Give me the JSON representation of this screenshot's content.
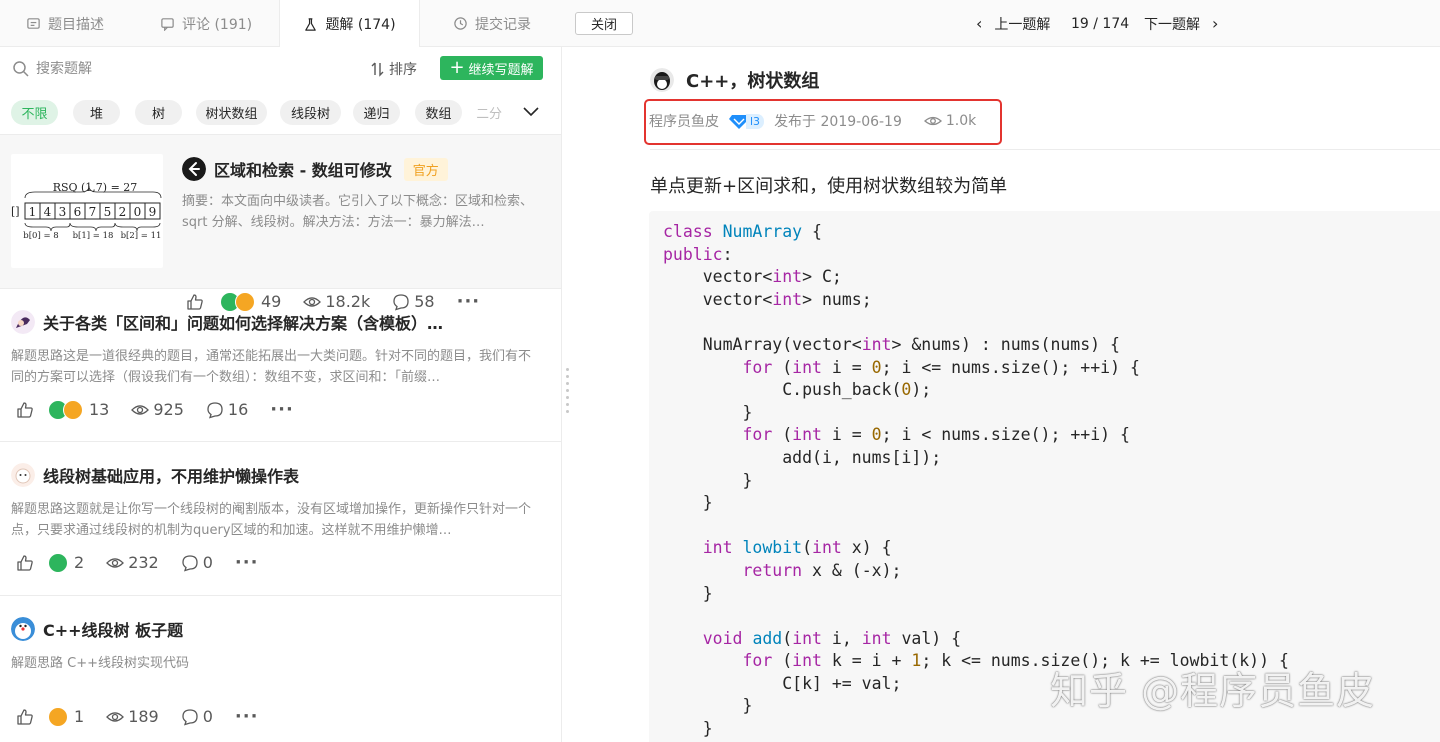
{
  "tabs": [
    {
      "label": "题目描述"
    },
    {
      "label": "评论 (191)"
    },
    {
      "label": "题解 (174)"
    },
    {
      "label": "提交记录"
    }
  ],
  "close_label": "关闭",
  "pager": {
    "prev_label": "上一题解",
    "position": "19 / 174",
    "next_label": "下一题解"
  },
  "search": {
    "placeholder": "搜索题解"
  },
  "sort_label": "排序",
  "write_label": "继续写题解",
  "tags": [
    "不限",
    "堆",
    "树",
    "树状数组",
    "线段树",
    "递归",
    "数组",
    "二分"
  ],
  "cards": [
    {
      "title": "区域和检索 - 数组可修改",
      "badge": "官方",
      "summary": "摘要：本文面向中级读者。它引入了以下概念：区域和检索、sqrt 分解、线段树。解决方法：方法一：暴力解法…",
      "reactions": "49",
      "views": "18.2k",
      "comments": "58",
      "thumb": {
        "caption": "RSQ (1,7) = 27",
        "array": [
          "1",
          "4",
          "3",
          "6",
          "7",
          "5",
          "2",
          "0",
          "9"
        ],
        "blocks": [
          "b[0] = 8",
          "b[1] = 18",
          "b[2] = 11"
        ]
      }
    },
    {
      "title": "关于各类「区间和」问题如何选择解决方案（含模板）…",
      "summary": "解题思路这是一道很经典的题目，通常还能拓展出一大类问题。针对不同的题目，我们有不同的方案可以选择（假设我们有一个数组）：数组不变，求区间和：「前缀…",
      "reactions": "13",
      "views": "925",
      "comments": "16"
    },
    {
      "title": "线段树基础应用，不用维护懒操作表",
      "summary": "解题思路这题就是让你写一个线段树的阉割版本，没有区域增加操作，更新操作只针对一个点，只要求通过线段树的机制为query区域的和加速。这样就不用维护懒增…",
      "reactions": "2",
      "views": "232",
      "comments": "0"
    },
    {
      "title": "C++线段树 板子题",
      "summary": "解题思路 C++线段树实现代码",
      "reactions": "1",
      "views": "189",
      "comments": "0"
    }
  ],
  "solution": {
    "title": "C++，树状数组",
    "author": "程序员鱼皮",
    "level": "l3",
    "published": "发布于 2019-06-19",
    "views": "1.0k",
    "lead": "单点更新+区间求和，使用树状数组较为简单"
  },
  "watermark": "知乎 @程序员鱼皮",
  "colors": {
    "accent_green": "#2db55d",
    "highlight_red": "#e3342f",
    "official_orange": "#f0a020",
    "level_blue": "#1f8ffb"
  }
}
